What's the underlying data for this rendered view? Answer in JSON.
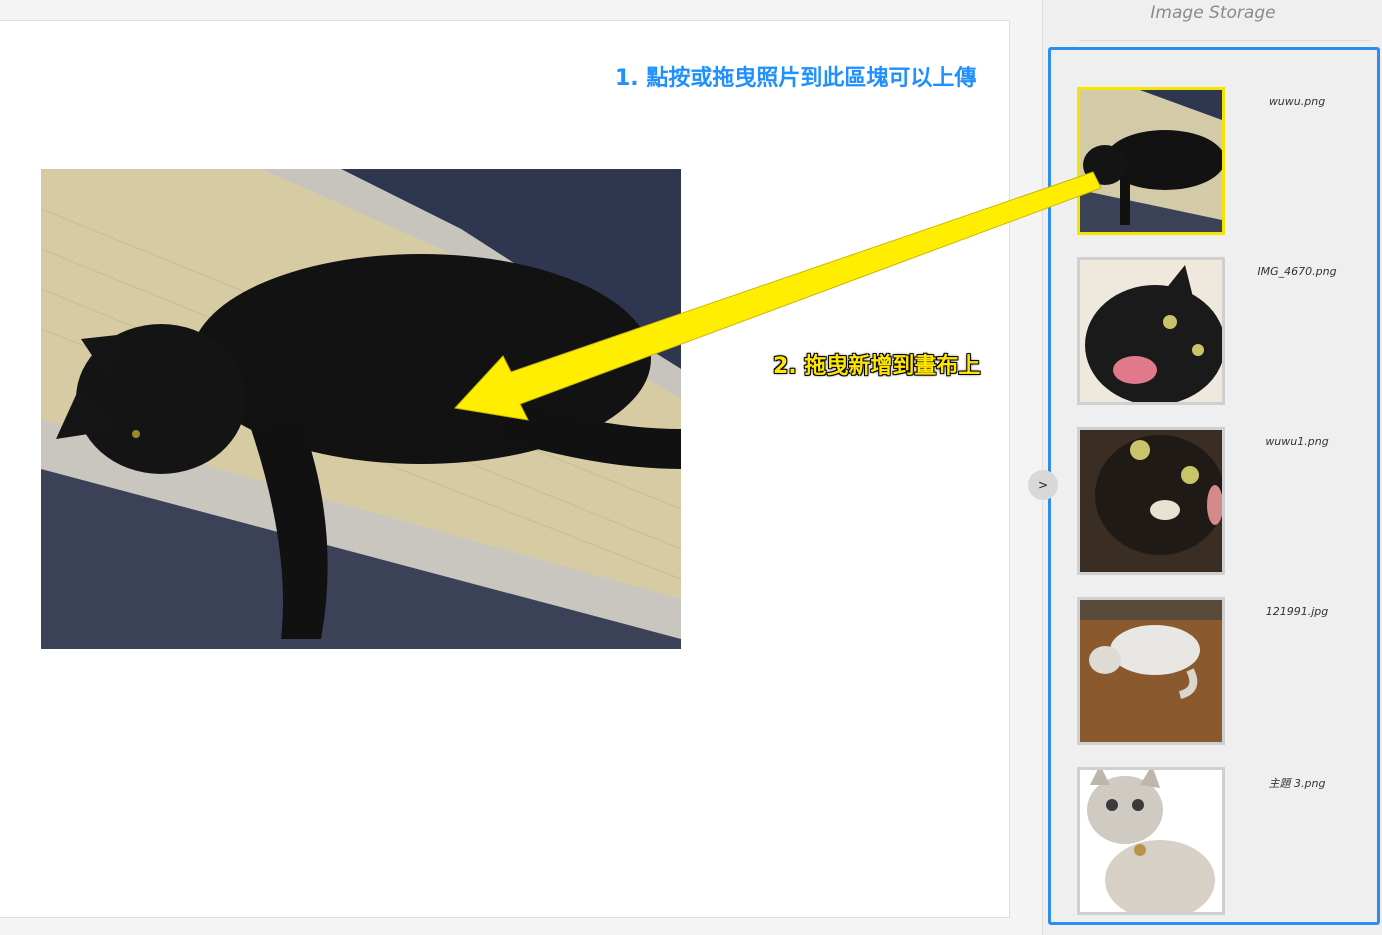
{
  "canvas": {
    "instructions": {
      "step1": "1. 點按或拖曳照片到此區塊可以上傳",
      "step2": "2. 拖曳新增到畫布上"
    },
    "photo_icon": "black-cat-photo"
  },
  "sidebar": {
    "title": "Image Storage",
    "toggle_label": ">",
    "drop_zone_color": "#2d8cf0",
    "items": [
      {
        "file_name": "wuwu.png",
        "selected": true,
        "icon": "black-cat-lying-thumbnail"
      },
      {
        "file_name": "IMG_4670.png",
        "selected": false,
        "icon": "black-cat-yawning-thumbnail"
      },
      {
        "file_name": "wuwu1.png",
        "selected": false,
        "icon": "black-cat-closeup-thumbnail"
      },
      {
        "file_name": "121991.jpg",
        "selected": false,
        "icon": "white-cat-on-floor-thumbnail"
      },
      {
        "file_name": "主題 3.png",
        "selected": false,
        "icon": "tabby-cat-cutout-thumbnail"
      }
    ]
  },
  "colors": {
    "arrow": "#ffee00",
    "annotation_blue": "#1e90ff",
    "selected_border": "#f5e400"
  }
}
